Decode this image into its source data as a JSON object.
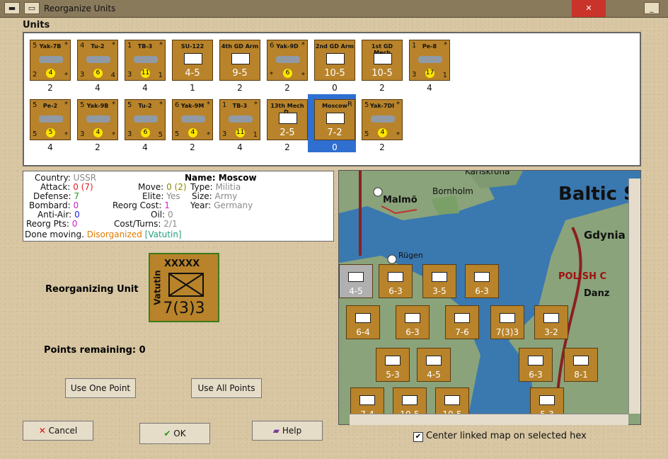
{
  "window": {
    "title": "Reorganize Units",
    "min_label": "_",
    "close_label": "✕"
  },
  "units_label": "Units",
  "units": [
    {
      "name": "Yak-7B",
      "tl": "5",
      "tr": "*",
      "bl": "2",
      "br": "*",
      "badge": "4",
      "count": "2",
      "kind": "air"
    },
    {
      "name": "Tu-2",
      "tl": "4",
      "tr": "*",
      "bl": "3",
      "br": "4",
      "badge": "6",
      "count": "4",
      "kind": "air"
    },
    {
      "name": "TB-3",
      "tl": "1",
      "tr": "*",
      "bl": "3",
      "br": "1",
      "badge": "11",
      "count": "4",
      "kind": "air"
    },
    {
      "name": "SU-122",
      "tl": "",
      "tr": "",
      "bl": "",
      "br": "",
      "str": "4-5",
      "count": "1",
      "kind": "land",
      "size": "xx"
    },
    {
      "name": "4th GD Arm",
      "tl": "",
      "tr": "",
      "bl": "",
      "br": "",
      "str": "9-5",
      "count": "2",
      "kind": "land",
      "size": "xxxx"
    },
    {
      "name": "Yak-9D",
      "tl": "6",
      "tr": "*",
      "bl": "*",
      "br": "*",
      "badge": "6",
      "count": "2",
      "kind": "air"
    },
    {
      "name": "2nd GD Arm",
      "tl": "",
      "tr": "",
      "bl": "",
      "br": "",
      "str": "10-5",
      "count": "0",
      "kind": "land",
      "size": "xxxx"
    },
    {
      "name": "1st GD Mech",
      "tl": "",
      "tr": "",
      "bl": "",
      "br": "",
      "str": "10-5",
      "count": "2",
      "kind": "land",
      "size": "xxxx"
    },
    {
      "name": "Pe-8",
      "tl": "1",
      "tr": "*",
      "bl": "3",
      "br": "1",
      "badge": "17",
      "count": "4",
      "kind": "air"
    },
    {
      "name": "Pe-2",
      "tl": "5",
      "tr": "*",
      "bl": "5",
      "br": "*",
      "badge": "5",
      "count": "4",
      "kind": "air"
    },
    {
      "name": "Yak-9B",
      "tl": "5",
      "tr": "*",
      "bl": "3",
      "br": "*",
      "badge": "4",
      "count": "2",
      "kind": "air"
    },
    {
      "name": "Tu-2",
      "tl": "5",
      "tr": "*",
      "bl": "3",
      "br": "5",
      "badge": "6",
      "count": "4",
      "kind": "air"
    },
    {
      "name": "Yak-9M",
      "tl": "6",
      "tr": "*",
      "bl": "5",
      "br": "*",
      "badge": "4",
      "count": "2",
      "kind": "air"
    },
    {
      "name": "TB-3",
      "tl": "1",
      "tr": "*",
      "bl": "3",
      "br": "1",
      "badge": "11",
      "count": "4",
      "kind": "air"
    },
    {
      "name": "13th Mech D.",
      "tl": "",
      "tr": "",
      "bl": "",
      "br": "",
      "str": "2-5",
      "count": "2",
      "kind": "land",
      "size": "xx"
    },
    {
      "name": "Moscow",
      "tl": "",
      "tr": "R",
      "bl": "",
      "br": "",
      "str": "7-2",
      "count": "0",
      "kind": "land",
      "size": "xxxx",
      "selected": true
    },
    {
      "name": "Yak-7DI",
      "tl": "5",
      "tr": "*",
      "bl": "5",
      "br": "*",
      "badge": "4",
      "count": "2",
      "kind": "air"
    }
  ],
  "info": {
    "country_label": "Country:",
    "country": "USSR",
    "attack_label": "Attack:",
    "attack": "0 (7)",
    "defense_label": "Defense:",
    "defense": "7",
    "bombard_label": "Bombard:",
    "bombard": "0",
    "antiair_label": "Anti-Air:",
    "antiair": "0",
    "reorgpts_label": "Reorg Pts:",
    "reorgpts": "0",
    "move_label": "Move:",
    "move": "0 (2)",
    "elite_label": "Elite:",
    "elite": "Yes",
    "reorgcost_label": "Reorg Cost:",
    "reorgcost": "1",
    "oil_label": "Oil:",
    "oil": "0",
    "costturns_label": "Cost/Turns:",
    "costturns": "2/1",
    "name_label": "Name:",
    "name": "Moscow",
    "type_label": "Type:",
    "type": "Militia",
    "size_label": "Size:",
    "size": "Army",
    "year_label": "Year:",
    "year": "Germany",
    "status_done": "Done moving.",
    "status_disorg": "Disorganized",
    "status_leader": "[Vatutin]"
  },
  "reorganizing_label": "Reorganizing Unit",
  "big_counter": {
    "size": "XXXXX",
    "leader": "Vatutin",
    "strength": "7(3)3"
  },
  "points_label": "Points remaining:",
  "points_value": "0",
  "buttons": {
    "use_one": "Use One Point",
    "use_all": "Use All Points",
    "cancel": "Cancel",
    "ok": "OK",
    "help": "Help"
  },
  "map": {
    "labels": {
      "baltic": "Baltic S",
      "malmo": "Malmö",
      "bornholm": "Bornholm",
      "gdynia": "Gdynia",
      "polish": "POLISH C",
      "danz": "Danz",
      "rugen": "Rügen",
      "karlskrona": "Karlskrona"
    },
    "counters": [
      "4-5",
      "6-3",
      "3-5",
      "6-3",
      "7-6",
      "7(3)3",
      "3-2",
      "6-4",
      "6-3",
      "5-3",
      "4-5",
      "6-3",
      "8-1",
      "7-4",
      "10-5",
      "10-5",
      "5-3"
    ]
  },
  "center_map_label": "Center linked map on selected hex",
  "colors": {
    "counter_brown": "#b8832a",
    "selected_blue": "#2f6fd0",
    "sea": "#3a78b0",
    "land": "#8aa37a"
  }
}
